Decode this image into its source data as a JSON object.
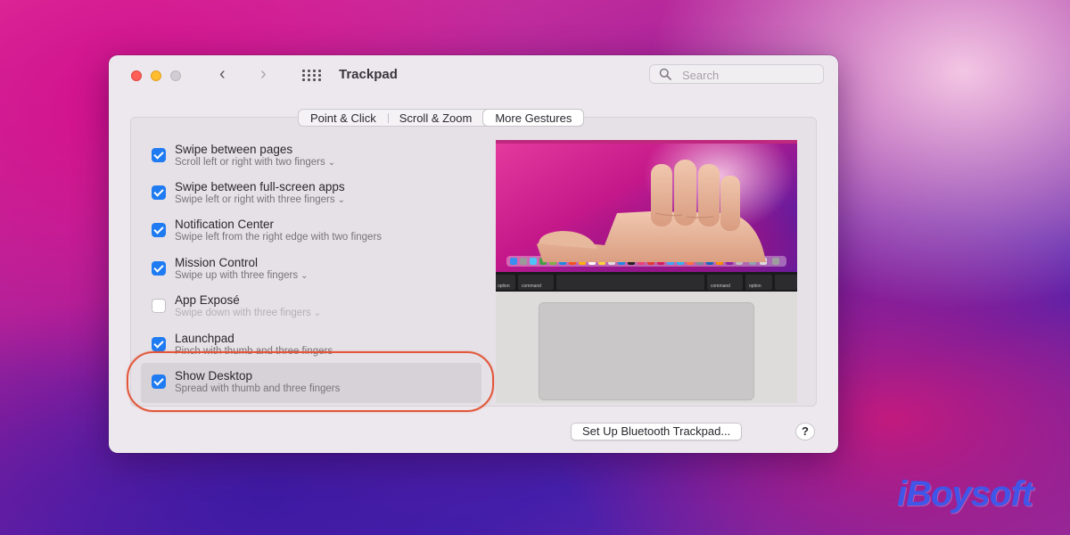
{
  "window": {
    "title": "Trackpad"
  },
  "toolbar": {
    "back_icon": "chevron-left-icon",
    "forward_icon": "chevron-right-icon",
    "grid_icon": "show-all-grid-icon",
    "back_glyph": "‹",
    "forward_glyph": "›"
  },
  "search": {
    "placeholder": "Search",
    "value": ""
  },
  "tabs": [
    {
      "label": "Point & Click",
      "active": false
    },
    {
      "label": "Scroll & Zoom",
      "active": false
    },
    {
      "label": "More Gestures",
      "active": true
    }
  ],
  "gestures": [
    {
      "title": "Swipe between pages",
      "subtitle": "Scroll left or right with two fingers",
      "checked": true,
      "has_menu": true
    },
    {
      "title": "Swipe between full-screen apps",
      "subtitle": "Swipe left or right with three fingers",
      "checked": true,
      "has_menu": true
    },
    {
      "title": "Notification Center",
      "subtitle": "Swipe left from the right edge with two fingers",
      "checked": true,
      "has_menu": false
    },
    {
      "title": "Mission Control",
      "subtitle": "Swipe up with three fingers",
      "checked": true,
      "has_menu": true
    },
    {
      "title": "App Exposé",
      "subtitle": "Swipe down with three fingers",
      "checked": false,
      "has_menu": true
    },
    {
      "title": "Launchpad",
      "subtitle": "Pinch with thumb and three fingers",
      "checked": true,
      "has_menu": false
    },
    {
      "title": "Show Desktop",
      "subtitle": "Spread with thumb and three fingers",
      "checked": true,
      "has_menu": false,
      "highlighted": true
    }
  ],
  "menu_chevron": "⌄",
  "preview": {
    "key_labels": [
      "option",
      "command",
      "command",
      "option"
    ]
  },
  "footer": {
    "bluetooth_button": "Set Up Bluetooth Trackpad...",
    "help_button": "?"
  },
  "watermark": "iBoysoft",
  "colors": {
    "accent": "#1f7bf2",
    "highlight_ring": "#e2573a",
    "watermark": "#3f56e8"
  }
}
